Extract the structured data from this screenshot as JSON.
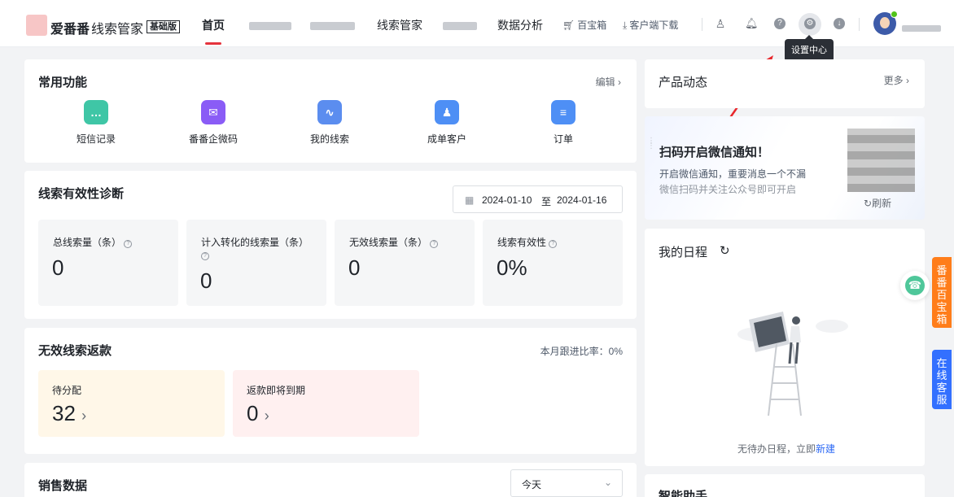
{
  "header": {
    "brand": "爱番番",
    "product": "线索管家",
    "edition": "基础版",
    "nav": [
      "首页",
      "线索管家",
      "数据分析"
    ],
    "tools": {
      "baibaoxiang": "百宝箱",
      "download": "客户端下载"
    },
    "tooltip": "设置中心"
  },
  "common_functions": {
    "title": "常用功能",
    "edit": "编辑",
    "items": [
      {
        "label": "短信记录",
        "icon": "message-icon",
        "color": "#3fc6a6"
      },
      {
        "label": "番番企微码",
        "icon": "wecom-code-icon",
        "color": "#8a5cf6"
      },
      {
        "label": "我的线索",
        "icon": "leads-icon",
        "color": "#5b8def"
      },
      {
        "label": "成单客户",
        "icon": "customer-icon",
        "color": "#4e8ff5"
      },
      {
        "label": "订单",
        "icon": "order-icon",
        "color": "#4e8ff5"
      }
    ]
  },
  "diagnosis": {
    "title": "线索有效性诊断",
    "date_from": "2024-01-10",
    "date_sep": "至",
    "date_to": "2024-01-16",
    "stats": [
      {
        "label": "总线索量（条）",
        "value": "0"
      },
      {
        "label": "计入转化的线索量（条）",
        "value": "0"
      },
      {
        "label": "无效线索量（条）",
        "value": "0"
      },
      {
        "label": "线索有效性",
        "value": "0%"
      }
    ]
  },
  "refund": {
    "title": "无效线索返款",
    "rate": "本月跟进比率：0%",
    "pending_label": "待分配",
    "pending_value": "32",
    "expire_label": "返款即将到期",
    "expire_value": "0"
  },
  "sales": {
    "title": "销售数据",
    "period": "今天"
  },
  "product_news": {
    "title": "产品动态",
    "more": "更多"
  },
  "wechat_notice": {
    "title": "扫码开启微信通知！",
    "line1": "开启微信通知，重要消息一个不漏",
    "line2": "微信扫码并关注公众号即可开启",
    "refresh": "刷新"
  },
  "schedule": {
    "title": "我的日程",
    "empty": "无待办日程，立即",
    "create": "新建"
  },
  "assistant": {
    "title": "智能助手"
  },
  "side_tabs": {
    "baibaoxiang": "番番百宝箱",
    "service": "在线客服"
  },
  "colors": {
    "accent": "#e5343d",
    "link": "#2f6bf5",
    "orange": "#ff7d1a",
    "blue": "#3370ff"
  }
}
